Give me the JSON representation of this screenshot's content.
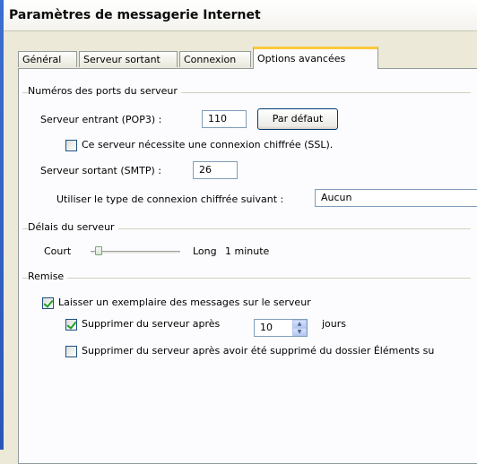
{
  "window": {
    "title": "Paramètres de messagerie Internet"
  },
  "tabs": [
    {
      "label": "Général",
      "active": false
    },
    {
      "label": "Serveur sortant",
      "active": false
    },
    {
      "label": "Connexion",
      "active": false
    },
    {
      "label": "Options avancées",
      "active": true
    }
  ],
  "ports": {
    "group_label": "Numéros des ports du serveur",
    "incoming_label": "Serveur entrant (POP3) :",
    "incoming_value": "110",
    "default_button": "Par défaut",
    "ssl_label": "Ce serveur nécessite une connexion chiffrée (SSL).",
    "ssl_checked": false,
    "outgoing_label": "Serveur sortant (SMTP) :",
    "outgoing_value": "26",
    "encryption_label": "Utiliser le type de connexion chiffrée suivant :",
    "encryption_value": "Aucun"
  },
  "timeouts": {
    "group_label": "Délais du serveur",
    "short_label": "Court",
    "long_label": "Long",
    "value_text": "1 minute",
    "slider_fraction": 0.05
  },
  "delivery": {
    "group_label": "Remise",
    "leave_copy_label": "Laisser un exemplaire des messages sur le serveur",
    "leave_copy_checked": true,
    "remove_after_label": "Supprimer du serveur après",
    "remove_after_checked": true,
    "remove_after_days": "10",
    "days_label": "jours",
    "remove_deleted_label": "Supprimer du serveur après avoir été supprimé du dossier Éléments su",
    "remove_deleted_checked": false
  },
  "colors": {
    "tab_highlight": "#ffc83c",
    "check_mark": "#21a121",
    "title_bar_edge": "#3b6fd0"
  }
}
